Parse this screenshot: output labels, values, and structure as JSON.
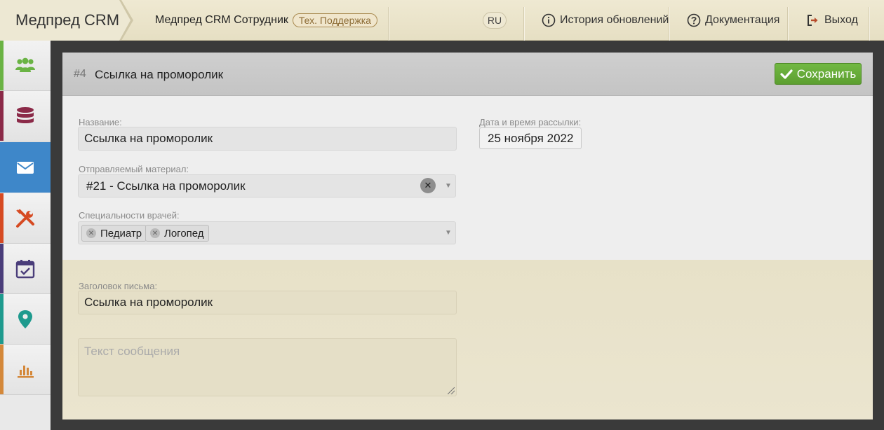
{
  "app": {
    "brand": "Медпред CRM"
  },
  "user": {
    "name": "Медпред CRM Сотрудник",
    "role": "Тех. Поддержка"
  },
  "topnav": {
    "language": "RU",
    "updates_label": "История обновлений",
    "docs_label": "Документация",
    "logout_label": "Выход"
  },
  "sidebar": {
    "items": [
      {
        "icon": "users-icon",
        "color": "#6ab344",
        "active": false
      },
      {
        "icon": "database-icon",
        "color": "#8b2a48",
        "active": false
      },
      {
        "icon": "envelope-icon",
        "color": "#3e87c9",
        "active": true
      },
      {
        "icon": "tools-icon",
        "color": "#d64a22",
        "active": false
      },
      {
        "icon": "calendar-check-icon",
        "color": "#4a3d7a",
        "active": false
      },
      {
        "icon": "map-marker-icon",
        "color": "#1e9a8e",
        "active": false
      },
      {
        "icon": "bar-chart-icon",
        "color": "#d4883a",
        "active": false
      }
    ]
  },
  "record": {
    "number": "#4",
    "title": "Ссылка на проморолик",
    "save_label": "Сохранить"
  },
  "form": {
    "name_label": "Название:",
    "name_value": "Ссылка на проморолик",
    "date_label": "Дата и время рассылки:",
    "date_value": "25 ноября 2022",
    "material_label": "Отправляемый материал:",
    "material_value": "#21 - Ссылка на проморолик",
    "specialties_label": "Специальности врачей:",
    "specialties": [
      "Педиатр",
      "Логопед"
    ],
    "subject_label": "Заголовок письма:",
    "subject_value": "Ссылка на проморолик",
    "message_placeholder": "Текст сообщения"
  },
  "colors": {
    "accent": "#3e87c9",
    "save": "#5fa332",
    "role_badge": "#8b6a33"
  }
}
